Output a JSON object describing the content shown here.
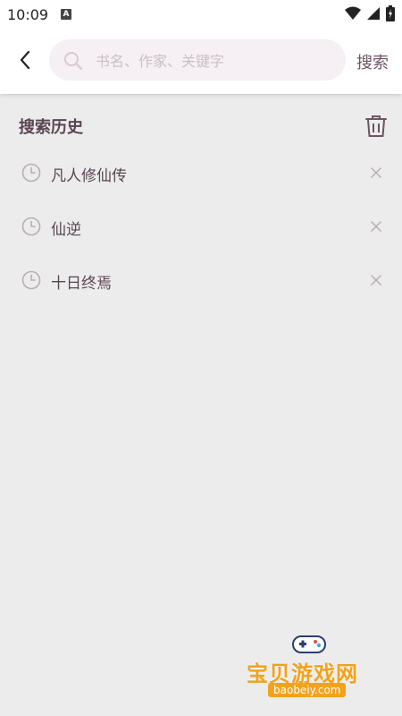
{
  "status_bar": {
    "time": "10:09",
    "notification_letter": "A"
  },
  "search": {
    "placeholder": "书名、作家、关键字",
    "value": "",
    "button_label": "搜索"
  },
  "history": {
    "title": "搜索历史",
    "items": [
      {
        "label": "凡人修仙传"
      },
      {
        "label": "仙逆"
      },
      {
        "label": "十日终焉"
      }
    ]
  },
  "watermark": {
    "text": "宝贝游戏网",
    "url": "baobeiy.com"
  },
  "colors": {
    "accent_text": "#6b5563",
    "search_bg": "#f6eff3",
    "page_bg": "#ececec",
    "watermark": "#f2a21b"
  },
  "icons": [
    "back-arrow-icon",
    "search-icon",
    "trash-icon",
    "clock-icon",
    "close-icon",
    "wifi-icon",
    "signal-icon",
    "battery-icon"
  ]
}
